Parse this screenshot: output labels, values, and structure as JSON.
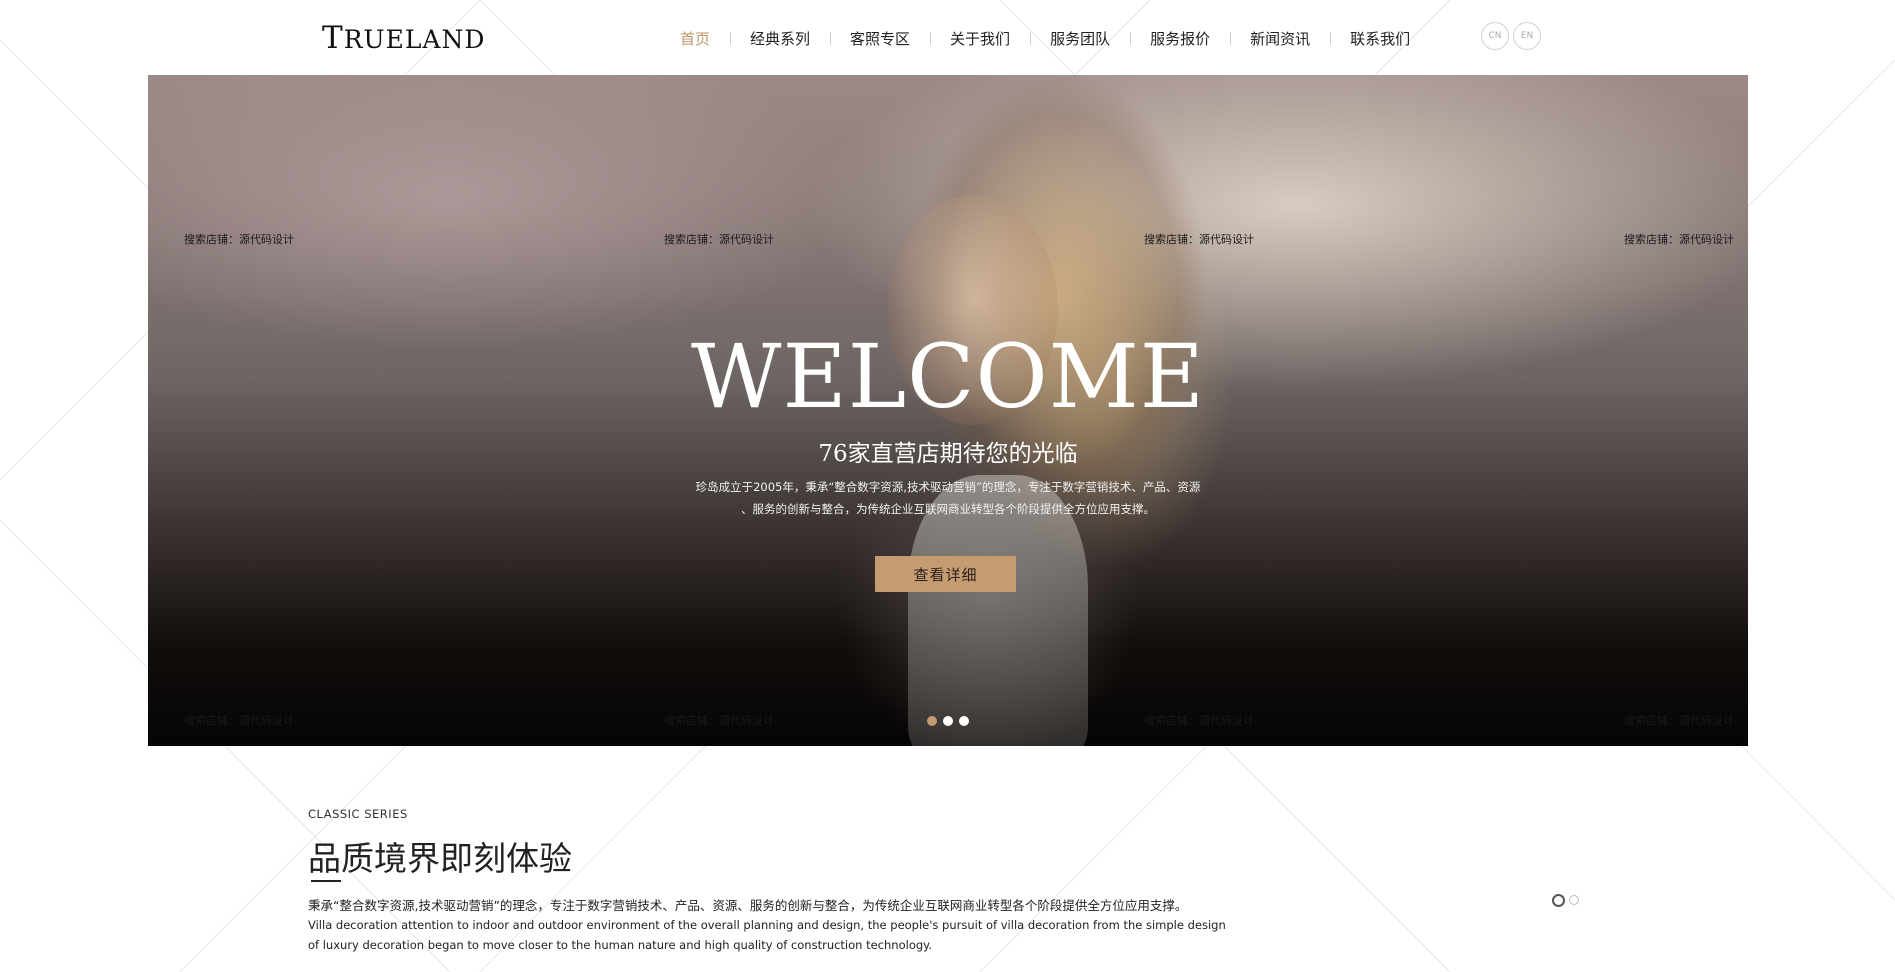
{
  "header": {
    "logo": {
      "first": "T",
      "rest": "RUELAND"
    },
    "nav": [
      {
        "label": "首页",
        "active": true
      },
      {
        "label": "经典系列"
      },
      {
        "label": "客照专区"
      },
      {
        "label": "关于我们"
      },
      {
        "label": "服务团队"
      },
      {
        "label": "服务报价"
      },
      {
        "label": "新闻资讯"
      },
      {
        "label": "联系我们"
      }
    ],
    "lang": [
      "CN",
      "EN"
    ]
  },
  "banner": {
    "watermark": "搜索店铺：源代码设计",
    "headline": "WELCOME",
    "subtitle": "76家直营店期待您的光临",
    "desc_line1": "珍岛成立于2005年，秉承“整合数字资源,技术驱动营销”的理念，专注于数字营销技术、产品、资源",
    "desc_line2": "、服务的创新与整合，为传统企业互联网商业转型各个阶段提供全方位应用支撑。",
    "cta": "查看详细",
    "slides": 3,
    "active_slide": 1
  },
  "classic": {
    "label": "CLASSIC SERIES",
    "title": "品质境界即刻体验",
    "text_cn": "秉承“整合数字资源,技术驱动营销”的理念，专注于数字营销技术、产品、资源、服务的创新与整合，为传统企业互联网商业转型各个阶段提供全方位应用支撑。",
    "text_en": "Villa decoration attention to indoor and outdoor environment of the overall planning and design, the people's pursuit of villa decoration from the simple design of luxury decoration began to move closer to the human nature and high quality of construction technology.",
    "slides": 2,
    "active_slide": 1
  },
  "colors": {
    "accent": "#c59c72",
    "nav_active": "#c2956a"
  }
}
